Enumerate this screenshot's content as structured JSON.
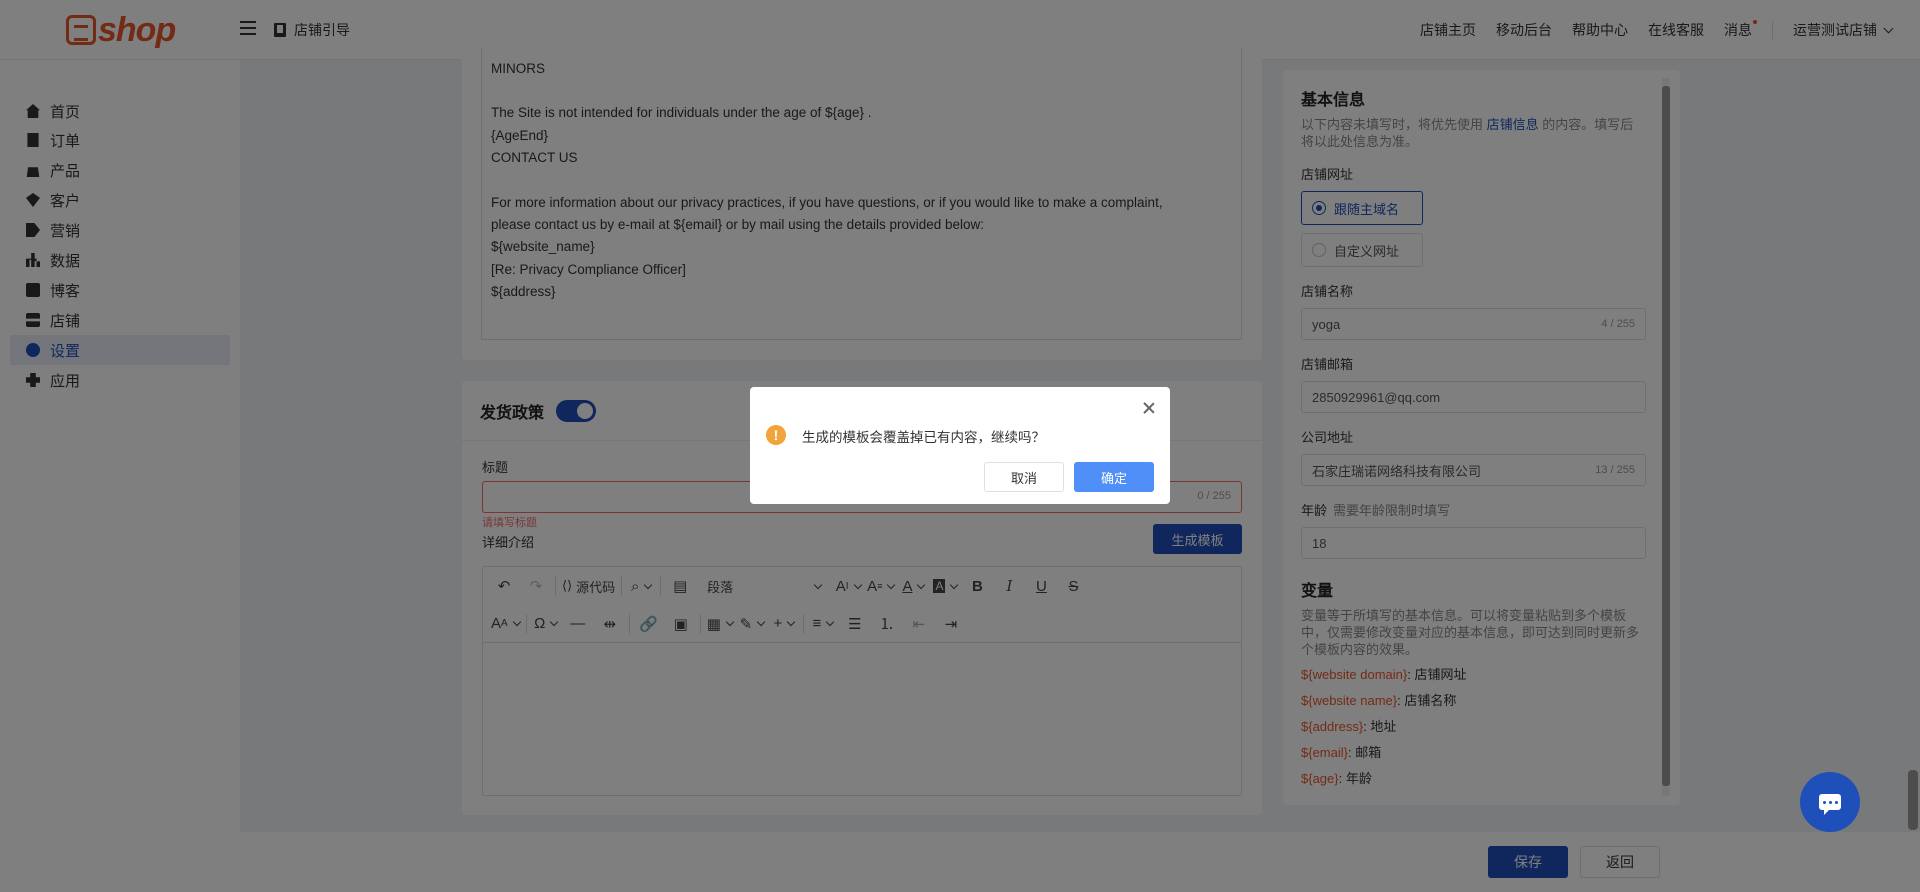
{
  "header": {
    "logo_text": "shop",
    "guide_label": "店铺引导",
    "nav": [
      "店铺主页",
      "移动后台",
      "帮助中心",
      "在线客服",
      "消息"
    ],
    "store_name": "运营测试店铺"
  },
  "sidebar": {
    "items": [
      {
        "label": "首页",
        "icon": "home-icon"
      },
      {
        "label": "订单",
        "icon": "order-icon"
      },
      {
        "label": "产品",
        "icon": "product-icon"
      },
      {
        "label": "客户",
        "icon": "customer-icon"
      },
      {
        "label": "营销",
        "icon": "tag-icon"
      },
      {
        "label": "数据",
        "icon": "chart-icon"
      },
      {
        "label": "博客",
        "icon": "blog-icon"
      },
      {
        "label": "店铺",
        "icon": "shop-icon"
      },
      {
        "label": "设置",
        "icon": "gear-icon",
        "active": true
      },
      {
        "label": "应用",
        "icon": "puzzle-icon"
      }
    ]
  },
  "privacy_doc": {
    "lines": [
      "MINORS",
      "",
      "The Site is not intended for individuals under the age of ${age} .",
      "{AgeEnd}",
      "CONTACT US",
      "",
      "For more information about our privacy practices, if you have questions, or if you would like to make a complaint,",
      "please contact us by e-mail at ${email} or by mail using the details provided below:",
      "${website_name}",
      "[Re: Privacy Compliance Officer]",
      "${address}"
    ]
  },
  "shipping": {
    "section_title": "发货政策",
    "enabled": true,
    "title_label": "标题",
    "title_value": "",
    "title_count": "0 / 255",
    "title_error": "请填写标题",
    "detail_label": "详细介绍",
    "generate_button": "生成模板",
    "toolbar": {
      "source_code": "源代码",
      "paragraph": "段落",
      "bold": "B",
      "italic": "I",
      "underline": "U",
      "strike": "S"
    }
  },
  "right_panel": {
    "basic_title": "基本信息",
    "basic_hint_pre": "以下内容未填写时，将优先使用",
    "basic_hint_link": "店铺信息",
    "basic_hint_post": "的内容。填写后将以此处信息为准。",
    "url_label": "店铺网址",
    "url_options": [
      "跟随主域名",
      "自定义网址"
    ],
    "url_selected": "跟随主域名",
    "name_label": "店铺名称",
    "name_value": "yoga",
    "name_count": "4 / 255",
    "email_label": "店铺邮箱",
    "email_value": "2850929961@qq.com",
    "address_label": "公司地址",
    "address_value": "石家庄瑞诺网络科技有限公司",
    "address_count": "13 / 255",
    "age_label": "年龄",
    "age_hint": "需要年龄限制时填写",
    "age_value": "18",
    "vars_title": "变量",
    "vars_hint": "变量等于所填写的基本信息。可以将变量粘贴到多个模板中，仅需要修改变量对应的基本信息，即可达到同时更新多个模板内容的效果。",
    "vars": [
      {
        "key": "${website domain}",
        "desc": ": 店铺网址"
      },
      {
        "key": "${website name}",
        "desc": ": 店铺名称"
      },
      {
        "key": "${address}",
        "desc": ": 地址"
      },
      {
        "key": "${email}",
        "desc": ": 邮箱"
      },
      {
        "key": "${age}",
        "desc": ": 年龄"
      }
    ]
  },
  "footer": {
    "save": "保存",
    "back": "返回"
  },
  "dialog": {
    "message": "生成的模板会覆盖掉已有内容，继续吗？",
    "cancel": "取消",
    "confirm": "确定"
  },
  "colors": {
    "brand": "#1f4fb8",
    "logo": "#e8562a",
    "warning": "#f2a33a",
    "error": "#f56c6c",
    "confirm": "#4f8ff7"
  }
}
